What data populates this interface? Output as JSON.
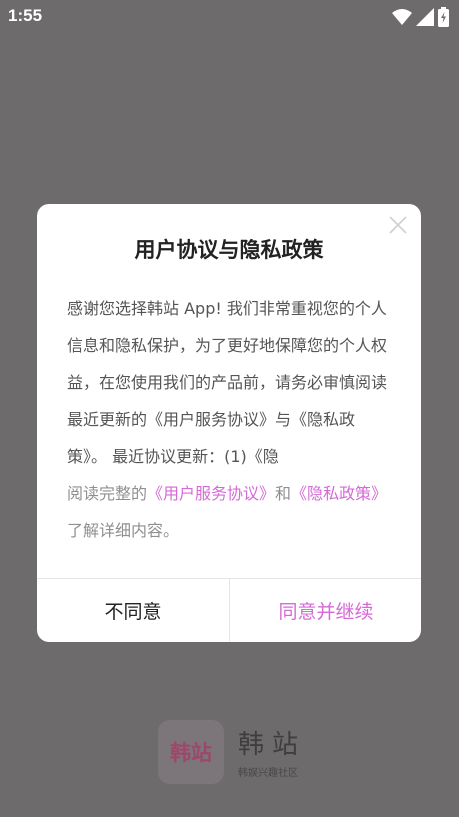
{
  "status_bar": {
    "time": "1:55",
    "icons": [
      "wifi-icon",
      "signal-icon",
      "battery-charging-icon"
    ]
  },
  "brand": {
    "logo_text": "韩站",
    "name": "韩站",
    "slogan": "韩娱兴趣社区"
  },
  "dialog": {
    "title": "用户协议与隐私政策",
    "body_intro": "感谢您选择韩站 App! 我们非常重视您的个人信息和隐私保护，为了更好地保障您的个人权益，在您使用我们的产品前，请务必审慎阅读最近更新的《用户服务协议》与《隐私政策》。 最近协议更新：(1)《隐",
    "body_read_prefix": "阅读完整的",
    "link_terms": "《用户服务协议》",
    "body_and": "和",
    "link_privacy": "《隐私政策》",
    "body_suffix": "了解详细内容。",
    "disagree_label": "不同意",
    "agree_label": "同意并继续"
  },
  "colors": {
    "overlay": "#6d6b6c",
    "accent": "#d56ad6",
    "brand_red": "#c22d6a"
  }
}
